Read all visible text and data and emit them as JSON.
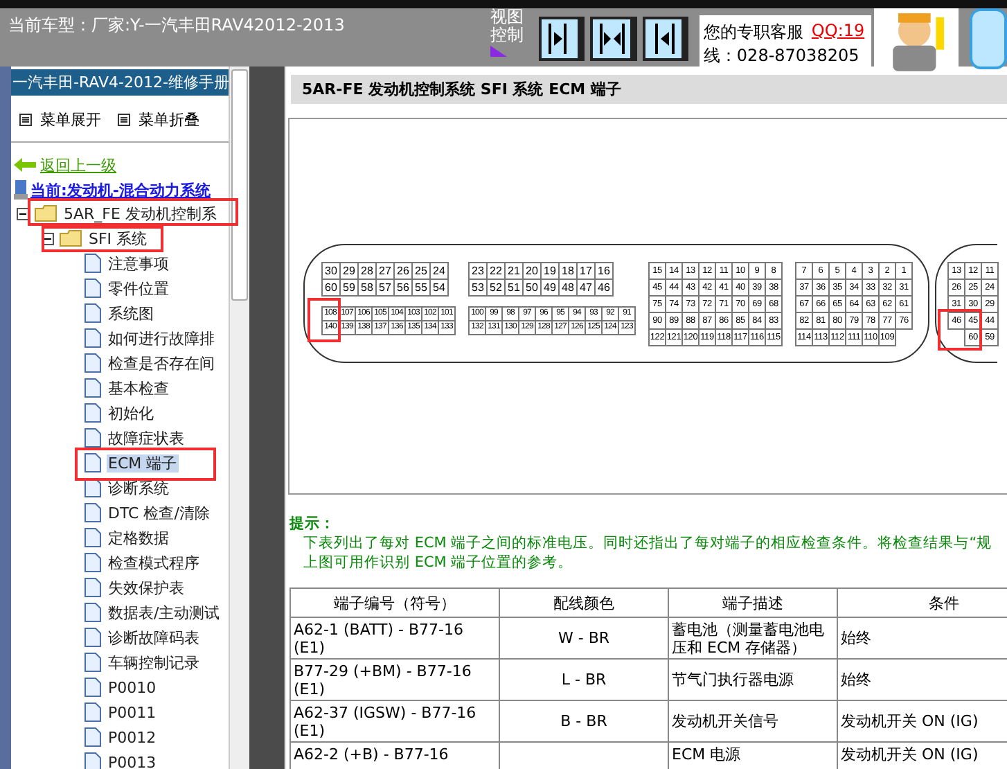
{
  "header": {
    "car_model": "当前车型：厂家:Y-一汽丰田RAV42012-2013",
    "view_label": "视图控制",
    "view_buttons": [
      {
        "kind": "right"
      },
      {
        "kind": "both"
      },
      {
        "kind": "left"
      }
    ],
    "support": {
      "label": "您的专职客服",
      "qq": "QQ:19",
      "phone": "线：028-87038205"
    }
  },
  "sidebar": {
    "title": "一汽丰田-RAV4-2012-维修手册",
    "menu_buttons": [
      "菜单展开",
      "菜单折叠"
    ],
    "back_link": "返回上一级",
    "current": "当前:发动机-混合动力系统",
    "tree": [
      {
        "label": "5AR_FE 发动机控制系",
        "expanded": true,
        "children": [
          {
            "label": "SFI 系统",
            "expanded": true,
            "children": [
              {
                "label": "注意事项",
                "selected": false
              },
              {
                "label": "零件位置",
                "selected": false
              },
              {
                "label": "系统图",
                "selected": false
              },
              {
                "label": "如何进行故障排",
                "selected": false
              },
              {
                "label": "检查是否存在间",
                "selected": false
              },
              {
                "label": "基本检查",
                "selected": false
              },
              {
                "label": "初始化",
                "selected": false
              },
              {
                "label": "故障症状表",
                "selected": false
              },
              {
                "label": "ECM 端子",
                "selected": true
              },
              {
                "label": "诊断系统",
                "selected": false
              },
              {
                "label": "DTC 检查/清除",
                "selected": false
              },
              {
                "label": "定格数据",
                "selected": false
              },
              {
                "label": "检查模式程序",
                "selected": false
              },
              {
                "label": "失效保护表",
                "selected": false
              },
              {
                "label": "数据表/主动测试",
                "selected": false
              },
              {
                "label": "诊断故障码表",
                "selected": false
              },
              {
                "label": "车辆控制记录",
                "selected": false
              },
              {
                "label": "P0010",
                "selected": false
              },
              {
                "label": "P0011",
                "selected": false
              },
              {
                "label": "P0012",
                "selected": false
              },
              {
                "label": "P0013",
                "selected": false
              }
            ]
          }
        ]
      }
    ]
  },
  "main": {
    "title": "5AR-FE 发动机控制系统  SFI 系统  ECM 端子",
    "connectors": [
      {
        "sections": [
          {
            "blocks": [
              {
                "kind": "large",
                "rows": [
                  [
                    "30",
                    "29",
                    "28",
                    "27",
                    "26",
                    "25",
                    "24"
                  ],
                  [
                    "60",
                    "59",
                    "58",
                    "57",
                    "56",
                    "55",
                    "54"
                  ]
                ]
              },
              {
                "kind": "small",
                "rows": [
                  [
                    "108",
                    "107",
                    "106",
                    "105",
                    "104",
                    "103",
                    "102",
                    "101"
                  ],
                  [
                    "140",
                    "139",
                    "138",
                    "137",
                    "136",
                    "135",
                    "134",
                    "133"
                  ]
                ]
              }
            ]
          },
          {
            "blocks": [
              {
                "kind": "large",
                "rows": [
                  [
                    "23",
                    "22",
                    "21",
                    "20",
                    "19",
                    "18",
                    "17",
                    "16"
                  ],
                  [
                    "53",
                    "52",
                    "51",
                    "50",
                    "49",
                    "48",
                    "47",
                    "46"
                  ]
                ]
              },
              {
                "kind": "small",
                "rows": [
                  [
                    "100",
                    "99",
                    "98",
                    "97",
                    "96",
                    "95",
                    "94",
                    "93",
                    "92",
                    "91"
                  ],
                  [
                    "132",
                    "131",
                    "130",
                    "129",
                    "128",
                    "127",
                    "126",
                    "125",
                    "124",
                    "123"
                  ]
                ]
              }
            ]
          },
          {
            "blocks": [
              {
                "kind": "medium",
                "rows": [
                  [
                    "15",
                    "14",
                    "13",
                    "12",
                    "11",
                    "10",
                    "9",
                    "8"
                  ],
                  [
                    "45",
                    "44",
                    "43",
                    "42",
                    "41",
                    "40",
                    "39",
                    "38"
                  ],
                  [
                    "75",
                    "74",
                    "73",
                    "72",
                    "71",
                    "70",
                    "69",
                    "68"
                  ],
                  [
                    "90",
                    "89",
                    "88",
                    "87",
                    "86",
                    "85",
                    "84",
                    "83"
                  ],
                  [
                    "122",
                    "121",
                    "120",
                    "119",
                    "118",
                    "117",
                    "116",
                    "115"
                  ]
                ]
              }
            ]
          },
          {
            "blocks": [
              {
                "kind": "medium",
                "rows": [
                  [
                    "7",
                    "6",
                    "5",
                    "4",
                    "3",
                    "2",
                    "1"
                  ],
                  [
                    "37",
                    "36",
                    "35",
                    "34",
                    "33",
                    "32",
                    "31"
                  ],
                  [
                    "67",
                    "66",
                    "65",
                    "64",
                    "63",
                    "62",
                    "61"
                  ],
                  [
                    "82",
                    "81",
                    "80",
                    "79",
                    "78",
                    "77",
                    "76"
                  ],
                  [
                    "114",
                    "113",
                    "112",
                    "111",
                    "110",
                    "109"
                  ]
                ]
              }
            ]
          }
        ]
      },
      {
        "sections": [
          {
            "blocks": [
              {
                "kind": "medium",
                "rows": [
                  [
                    "13",
                    "12",
                    "11"
                  ],
                  [
                    "26",
                    "25",
                    "24"
                  ],
                  [
                    "31",
                    "30",
                    "29"
                  ],
                  [
                    "46",
                    "45",
                    "44"
                  ],
                  [
                    "",
                    "60",
                    "59"
                  ]
                ]
              }
            ]
          }
        ]
      }
    ],
    "hint": {
      "label": "提示：",
      "lines": [
        "下表列出了每对 ECM 端子之间的标准电压。同时还指出了每对端子的相应检查条件。将检查结果与“规",
        "上图可用作识别 ECM 端子位置的参考。"
      ]
    },
    "table": {
      "columns": [
        "端子编号（符号）",
        "配线颜色",
        "端子描述",
        "条件"
      ],
      "rows": [
        [
          "A62-1 (BATT) - B77-16 (E1)",
          "W - BR",
          "蓄电池（测量蓄电池电压和 ECM 存储器）",
          "始终"
        ],
        [
          "B77-29 (+BM) - B77-16 (E1)",
          "L - BR",
          "节气门执行器电源",
          "始终"
        ],
        [
          "A62-37 (IGSW) - B77-16 (E1)",
          "B - BR",
          "发动机开关信号",
          "发动机开关 ON (IG)"
        ],
        [
          "A62-2 (+B) - B77-16",
          "",
          "ECM 电源",
          "发动机开关 ON (IG)"
        ]
      ]
    }
  }
}
